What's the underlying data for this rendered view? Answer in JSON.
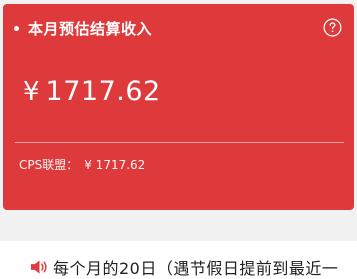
{
  "card": {
    "title": "本月预估结算收入",
    "currency": "¥",
    "amount": "1717.62",
    "cps_label": "CPS联盟：",
    "cps_value": "¥ 1717.62",
    "bg_color": "#de3a3c"
  },
  "icons": {
    "help": "help-circle-icon",
    "speaker": "speaker-icon"
  },
  "notice": {
    "text": "每个月的20日（遇节假日提前到最近一"
  }
}
